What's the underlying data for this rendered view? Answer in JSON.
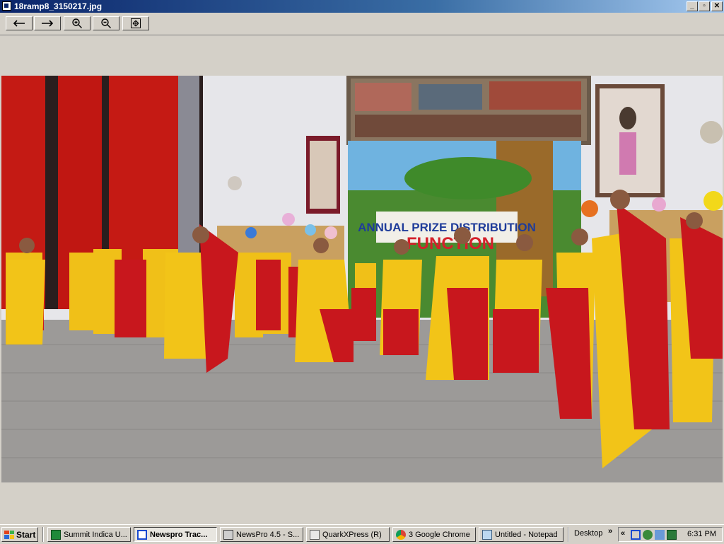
{
  "window": {
    "title": "18ramp8_3150217.jpg",
    "controls": {
      "minimize": "_",
      "maximize": "▫",
      "close": "✕"
    }
  },
  "toolbar": {
    "buttons": [
      {
        "name": "previous",
        "icon": "arrow-left-icon"
      },
      {
        "name": "next",
        "icon": "arrow-right-icon"
      },
      {
        "name": "zoom-in",
        "icon": "zoom-in-icon"
      },
      {
        "name": "zoom-out",
        "icon": "zoom-out-icon"
      },
      {
        "name": "fit",
        "icon": "fit-screen-icon"
      }
    ]
  },
  "photo": {
    "banner_line1": "ANNUAL PRIZE DISTRIBUTION",
    "banner_line2": "FUNCTION",
    "colors": {
      "saree_yellow": "#f2c418",
      "saree_red": "#c8171d",
      "floor": "#9c9a98",
      "wall": "#e8e8ec",
      "pillar": "#c51a14"
    }
  },
  "taskbar": {
    "start_label": "Start",
    "tasks": [
      {
        "label": "Summit Indica U...",
        "icon": "summit-icon",
        "active": false
      },
      {
        "label": "Newspro Trac...",
        "icon": "newspro-icon",
        "active": true
      },
      {
        "label": "NewsPro 4.5 - S...",
        "icon": "newspro-app-icon",
        "active": false
      },
      {
        "label": "QuarkXPress (R)",
        "icon": "quark-icon",
        "active": false
      },
      {
        "label": "3 Google Chrome",
        "icon": "chrome-icon",
        "active": false
      },
      {
        "label": "Untitled - Notepad",
        "icon": "notepad-icon",
        "active": false
      }
    ],
    "desktop_label": "Desktop",
    "toolbar_chevron": "»",
    "tray_chevron": "«",
    "clock": "6:31 PM"
  }
}
